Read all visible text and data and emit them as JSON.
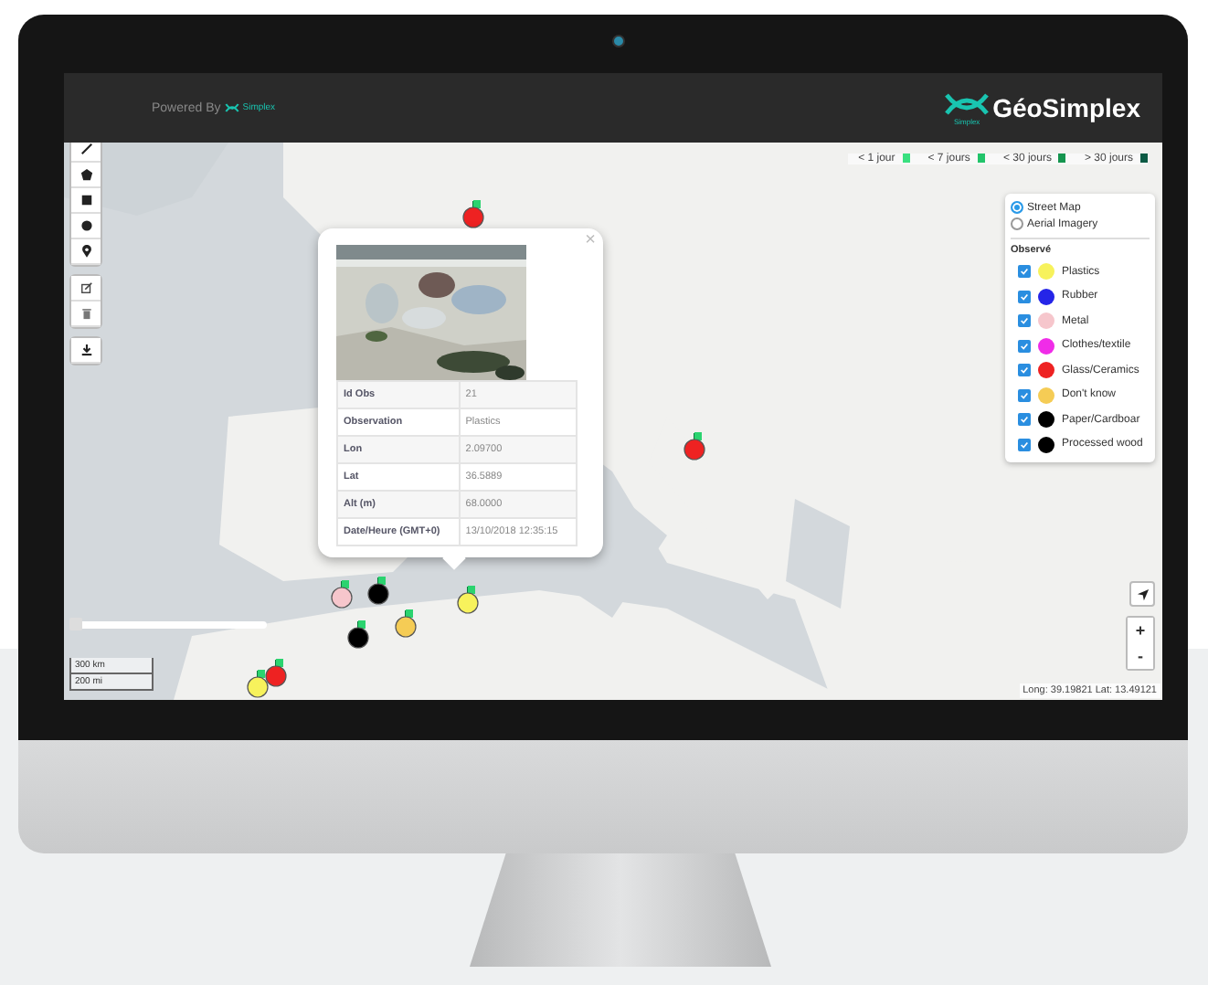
{
  "header": {
    "powered_by": "Powered By",
    "powered_logo": "Simplex",
    "brand": "GéoSimplex",
    "brand_sub": "Simplex"
  },
  "age_legend": [
    {
      "label": "< 1 jour",
      "color": "#39e07f"
    },
    {
      "label": "< 7 jours",
      "color": "#22c46a"
    },
    {
      "label": "< 30 jours",
      "color": "#15954f"
    },
    {
      "label": "> 30 jours",
      "color": "#0c5a44"
    }
  ],
  "base_layers": [
    {
      "label": "Street Map",
      "selected": true
    },
    {
      "label": "Aerial Imagery",
      "selected": false
    }
  ],
  "overlay": {
    "title": "Observé",
    "items": [
      {
        "label": "Plastics",
        "color": "#f7f25c",
        "checked": true
      },
      {
        "label": "Rubber",
        "color": "#2525e8",
        "checked": true
      },
      {
        "label": "Metal",
        "color": "#f6c6cc",
        "checked": true
      },
      {
        "label": "Clothes/textile",
        "color": "#f02ce8",
        "checked": true
      },
      {
        "label": "Glass/Ceramics",
        "color": "#ee2222",
        "checked": true
      },
      {
        "label": "Don't know",
        "color": "#f5cc55",
        "checked": true
      },
      {
        "label": "Paper/Cardboar",
        "color": "#000000",
        "checked": true
      },
      {
        "label": "Processed wood",
        "color": "#000000",
        "checked": true
      }
    ]
  },
  "markers": [
    {
      "color": "#ee2222"
    },
    {
      "color": "#ee2222"
    },
    {
      "color": "#f6c6cc"
    },
    {
      "color": "#000000"
    },
    {
      "color": "#000000"
    },
    {
      "color": "#f5cc55"
    },
    {
      "color": "#f7f25c"
    },
    {
      "color": "#ee2222"
    },
    {
      "color": "#f7f25c"
    }
  ],
  "popup": {
    "close": "×",
    "rows": [
      {
        "key": "Id Obs",
        "value": "21"
      },
      {
        "key": "Observation",
        "value": "Plastics"
      },
      {
        "key": "Lon",
        "value": "2.09700"
      },
      {
        "key": "Lat",
        "value": "36.5889"
      },
      {
        "key": "Alt (m)",
        "value": "68.0000"
      },
      {
        "key": "Date/Heure (GMT+0)",
        "value": "13/10/2018 12:35:15"
      }
    ]
  },
  "time_slider": {
    "level": 0
  },
  "scale": [
    "300 km",
    "200 mi"
  ],
  "zoom": {
    "in": "+",
    "out": "-"
  },
  "coordinates": "Long: 39.19821 Lat: 13.49121"
}
